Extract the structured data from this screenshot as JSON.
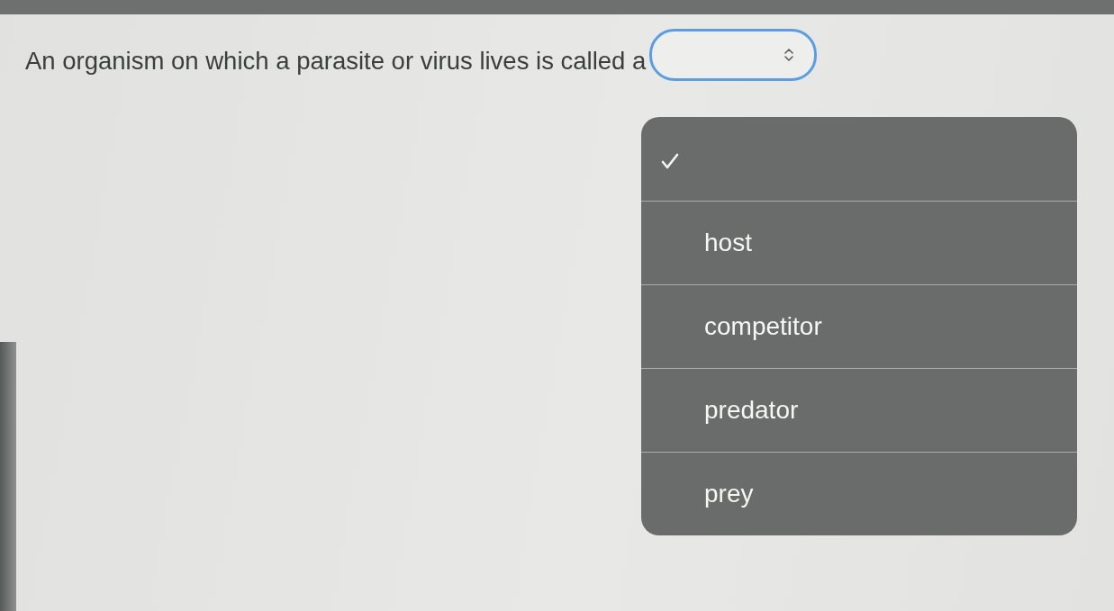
{
  "question": {
    "text": "An organism on which a parasite or virus lives is called a",
    "select": {
      "focused": true,
      "expanded": true,
      "options": [
        {
          "selected": true
        },
        {
          "label": "host",
          "selected": false
        },
        {
          "label": "competitor",
          "selected": false
        },
        {
          "label": "predator",
          "selected": false
        },
        {
          "label": "prey",
          "selected": false
        }
      ]
    }
  }
}
